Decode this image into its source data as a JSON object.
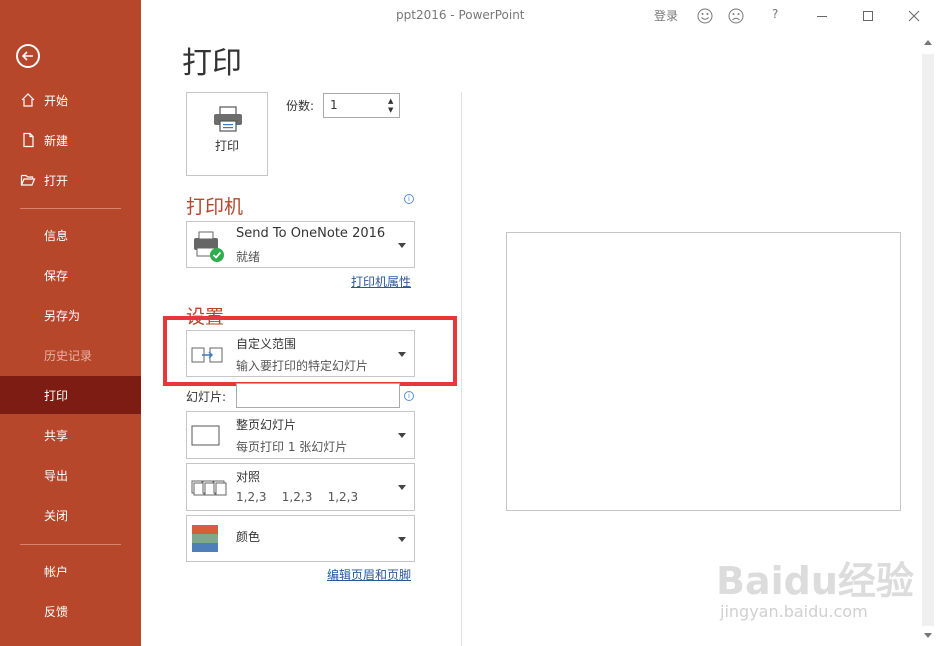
{
  "window": {
    "title": "ppt2016 - PowerPoint",
    "signin": "登录",
    "help": "?"
  },
  "sidebar": {
    "items": [
      {
        "label": "开始",
        "icon": "home-icon"
      },
      {
        "label": "新建",
        "icon": "new-file-icon"
      },
      {
        "label": "打开",
        "icon": "folder-open-icon"
      },
      {
        "label": "信息"
      },
      {
        "label": "保存"
      },
      {
        "label": "另存为"
      },
      {
        "label": "历史记录"
      },
      {
        "label": "打印"
      },
      {
        "label": "共享"
      },
      {
        "label": "导出"
      },
      {
        "label": "关闭"
      },
      {
        "label": "帐户"
      },
      {
        "label": "反馈"
      }
    ],
    "active_index": 7,
    "colors": {
      "bg": "#b7472a",
      "active": "#7c1c12"
    }
  },
  "main": {
    "title": "打印",
    "print_button": "打印",
    "copies_label": "份数:",
    "copies_value": "1",
    "printer_section": "打印机",
    "printer": {
      "name": "Send To OneNote 2016",
      "status": "就绪"
    },
    "printer_properties": "打印机属性",
    "settings_section": "设置",
    "range": {
      "title": "自定义范围",
      "subtitle": "输入要打印的特定幻灯片"
    },
    "slides_label": "幻灯片:",
    "layout": {
      "title": "整页幻灯片",
      "subtitle": "每页打印 1 张幻灯片"
    },
    "collate": {
      "title": "对照",
      "subtitle": "1,2,3    1,2,3    1,2,3"
    },
    "color": {
      "title": "颜色"
    },
    "edit_header_footer": "编辑页眉和页脚"
  },
  "watermark": {
    "brand": "Baidu经验",
    "url": "jingyan.baidu.com"
  }
}
